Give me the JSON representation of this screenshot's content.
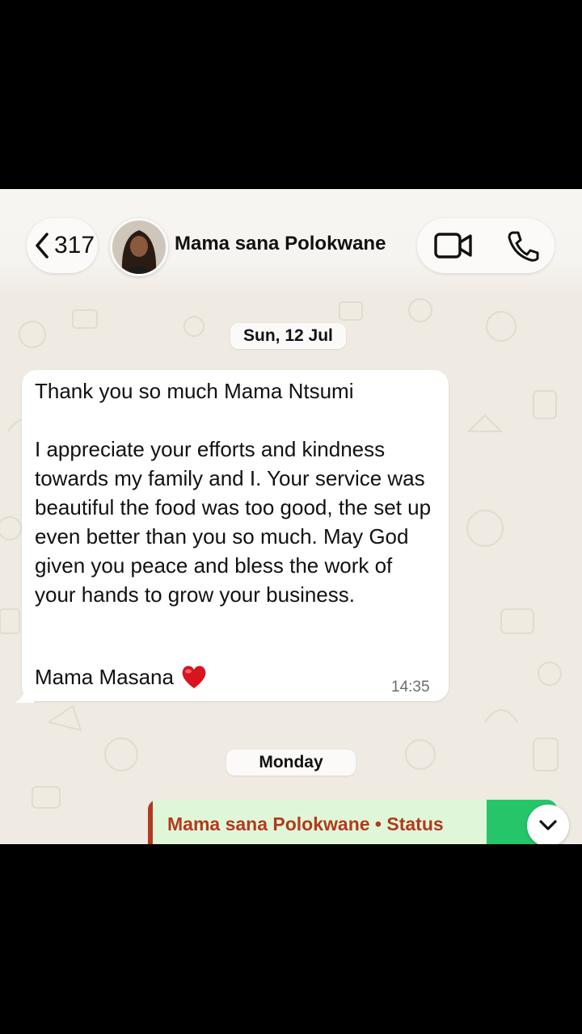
{
  "header": {
    "back_count": "317",
    "contact_name": "Mama sana Polokwane",
    "icons": [
      "chevron-left-icon",
      "video-camera-icon",
      "phone-icon"
    ]
  },
  "chat": {
    "date_1": "Sun, 12 Jul",
    "message": {
      "text": "Thank you so much Mama Ntsumi\n\nI appreciate your efforts and kindness towards my family and I. Your service was beautiful the food was too good, the set up even better than you so much. May God given you peace and bless the work of your hands to grow your business.",
      "signoff": "Mama Masana",
      "emoji": "heart",
      "time": "14:35"
    },
    "date_2": "Monday",
    "reply_preview": {
      "title": "Mama sana Polokwane • Status"
    }
  },
  "colors": {
    "chat_bg": "#efeae2",
    "bubble_in": "#ffffff",
    "reply_accent": "#b23a1e",
    "reply_bg": "#dff7d8",
    "heart": "#d8141f"
  }
}
